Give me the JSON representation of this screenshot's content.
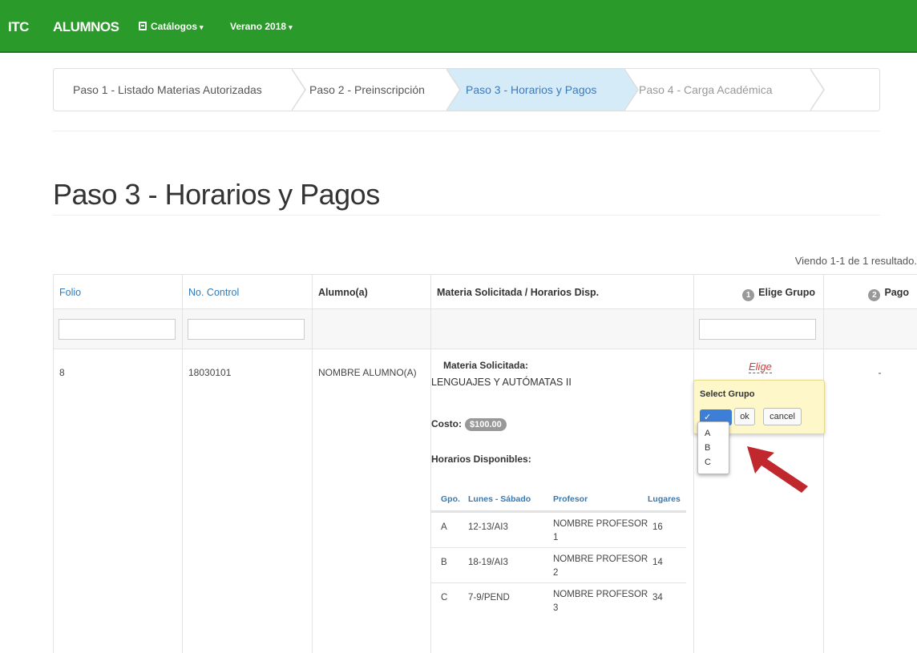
{
  "navbar": {
    "brand": "ITC",
    "alumnos": "ALUMNOS",
    "catalogos": "Catálogos",
    "periodo": "Verano 2018",
    "caret": "▾"
  },
  "wizard": {
    "steps": [
      {
        "label": "Paso 1 - Listado Materias Autorizadas"
      },
      {
        "label": "Paso 2 - Preinscripción"
      },
      {
        "label": "Paso 3 - Horarios y Pagos"
      },
      {
        "label": "Paso 4 - Carga Académica"
      }
    ]
  },
  "page": {
    "title": "Paso 3 - Horarios y Pagos",
    "summary": "Viendo 1-1 de 1 resultado."
  },
  "table": {
    "headers": {
      "folio": "Folio",
      "control": "No. Control",
      "alumno": "Alumno(a)",
      "materia": "Materia Solicitada / Horarios Disp.",
      "grupo_num": "1",
      "grupo": "Elige Grupo",
      "pago_num": "2",
      "pago": "Pago"
    },
    "row": {
      "folio": "8",
      "control": "18030101",
      "alumno": "NOMBRE ALUMNO(A)",
      "materia_label": "Materia Solicitada:",
      "materia_name": "LENGUAJES Y AUTÓMATAS II",
      "costo_label": "Costo:",
      "costo": "$100.00",
      "horarios_label": "Horarios Disponibles:",
      "elige": "Elige",
      "pago": "-"
    },
    "schedule": {
      "headers": [
        "Gpo.",
        "Lunes - Sábado",
        "Profesor",
        "Lugares"
      ],
      "rows": [
        {
          "gpo": "A",
          "horario": "12-13/AI3",
          "profesor": "NOMBRE PROFESOR",
          "num": "1",
          "lugares": "16"
        },
        {
          "gpo": "B",
          "horario": "18-19/AI3",
          "profesor": "NOMBRE PROFESOR",
          "num": "2",
          "lugares": "14"
        },
        {
          "gpo": "C",
          "horario": "7-9/PEND",
          "profesor": "NOMBRE PROFESOR",
          "num": "3",
          "lugares": "34"
        }
      ]
    }
  },
  "popover": {
    "title": "Select Grupo",
    "selected": "✓",
    "ok": "ok",
    "cancel": "cancel",
    "options": [
      "A",
      "B",
      "C"
    ]
  },
  "colors": {
    "navbar": "#2a9a2a",
    "active_step": "#d6ebf8",
    "link": "#337ab7",
    "elige": "#d43f3a",
    "popover": "#fdf7c9",
    "arrow": "#c0282d"
  },
  "icons": {
    "catalogos": "book-icon",
    "callout": "red-arrow-icon"
  }
}
